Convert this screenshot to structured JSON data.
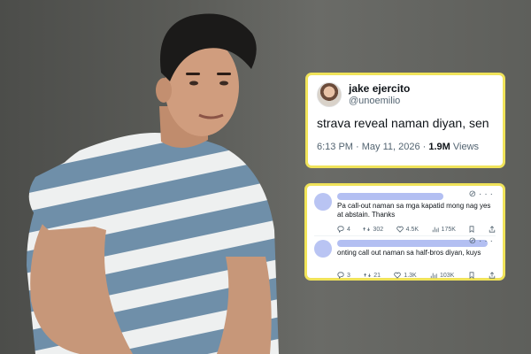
{
  "tweet": {
    "name": "jake ejercito",
    "handle": "@unoemilio",
    "text": "strava reveal naman diyan, sen",
    "time": "6:13 PM · May 11, 2026 · ",
    "views_count": "1.9M",
    "views_label": " Views"
  },
  "replies": [
    {
      "text": "Pa call-out naman sa mga kapatid mong nag yes at abstain. Thanks",
      "replies": "4",
      "reposts": "302",
      "likes": "4.5K",
      "views": "175K"
    },
    {
      "text": "onting call out naman sa half-bros diyan, kuys",
      "replies": "3",
      "reposts": "21",
      "likes": "1.3K",
      "views": "103K"
    }
  ],
  "icons": {
    "reply": "reply-icon",
    "repost": "repost-icon",
    "like": "heart-icon",
    "views": "views-icon",
    "bookmark": "bookmark-icon",
    "share": "share-icon",
    "grok": "grok-icon",
    "more": "more-icon"
  },
  "colors": {
    "highlight_border": "#f0e35a",
    "redaction": "#b3bff2"
  }
}
